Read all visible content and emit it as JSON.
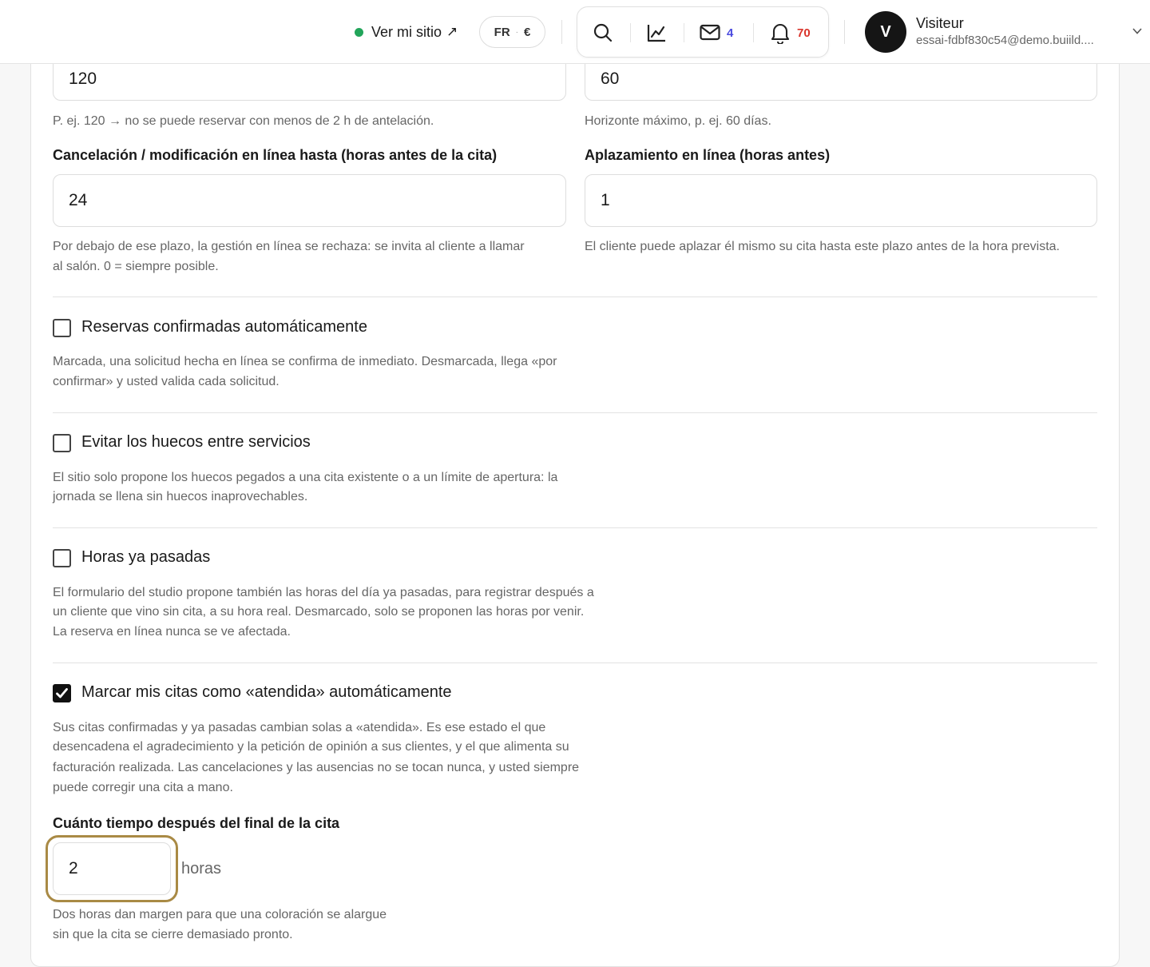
{
  "header": {
    "site_link_label": "Ver mi sitio",
    "site_link_arrow": "↗",
    "locale": "FR",
    "locale_sep": "·",
    "currency": "€",
    "messages_count": "4",
    "notifications_count": "70",
    "user_initial": "V",
    "user_name": "Visiteur",
    "user_email": "essai-fdbf830c54@demo.buiild...."
  },
  "booking": {
    "min_notice_value": "120",
    "min_notice_help": "P. ej. 120 → no se puede reservar con menos de 2 h de antelación.",
    "horizon_value": "60",
    "horizon_help": "Horizonte máximo, p. ej. 60 días.",
    "cancel_label": "Cancelación / modificación en línea hasta (horas antes de la cita)",
    "cancel_value": "24",
    "cancel_help_1": "Por debajo de ese plazo, la gestión en línea se rechaza: se invita al cliente a llamar",
    "cancel_help_2": "al salón. 0 = siempre posible.",
    "postpone_label": "Aplazamiento en línea (horas antes)",
    "postpone_value": "1",
    "postpone_help": "El cliente puede aplazar él mismo su cita hasta este plazo antes de la hora prevista."
  },
  "options": {
    "auto_confirm": {
      "checked": false,
      "label": "Reservas confirmadas automáticamente",
      "help_1": "Marcada, una solicitud hecha en línea se confirma de inmediato. Desmarcada, llega «por",
      "help_2": "confirmar» y usted valida cada solicitud."
    },
    "avoid_gaps": {
      "checked": false,
      "label": "Evitar los huecos entre servicios",
      "help_1": "El sitio solo propone los huecos pegados a una cita existente o a un límite de apertura: la",
      "help_2": "jornada se llena sin huecos inaprovechables."
    },
    "past_hours": {
      "checked": false,
      "label": "Horas ya pasadas",
      "help_1": "El formulario del studio propone también las horas del día ya pasadas, para registrar después a",
      "help_2": "un cliente que vino sin cita, a su hora real. Desmarcado, solo se proponen las horas por venir.",
      "help_3": "La reserva en línea nunca se ve afectada."
    },
    "auto_attended": {
      "checked": true,
      "label": "Marcar mis citas como «atendida» automáticamente",
      "help_1": "Sus citas confirmadas y ya pasadas cambian solas a «atendida». Es ese estado el que",
      "help_2": "desencadena el agradecimiento y la petición de opinión a sus clientes, y el que alimenta su",
      "help_3": "facturación realizada. Las cancelaciones y las ausencias no se tocan nunca, y usted siempre",
      "help_4": "puede corregir una cita a mano.",
      "delay_label": "Cuánto tiempo después del final de la cita",
      "delay_value": "2",
      "delay_unit": "horas",
      "delay_help_1": "Dos horas dan margen para que una coloración se alargue",
      "delay_help_2": "sin que la cita se cierre demasiado pronto."
    }
  },
  "colors": {
    "accent_focus": "#a98a45",
    "status_online": "#22a55a",
    "badge_messages": "#4a4adf",
    "badge_notifications": "#d9342b"
  }
}
